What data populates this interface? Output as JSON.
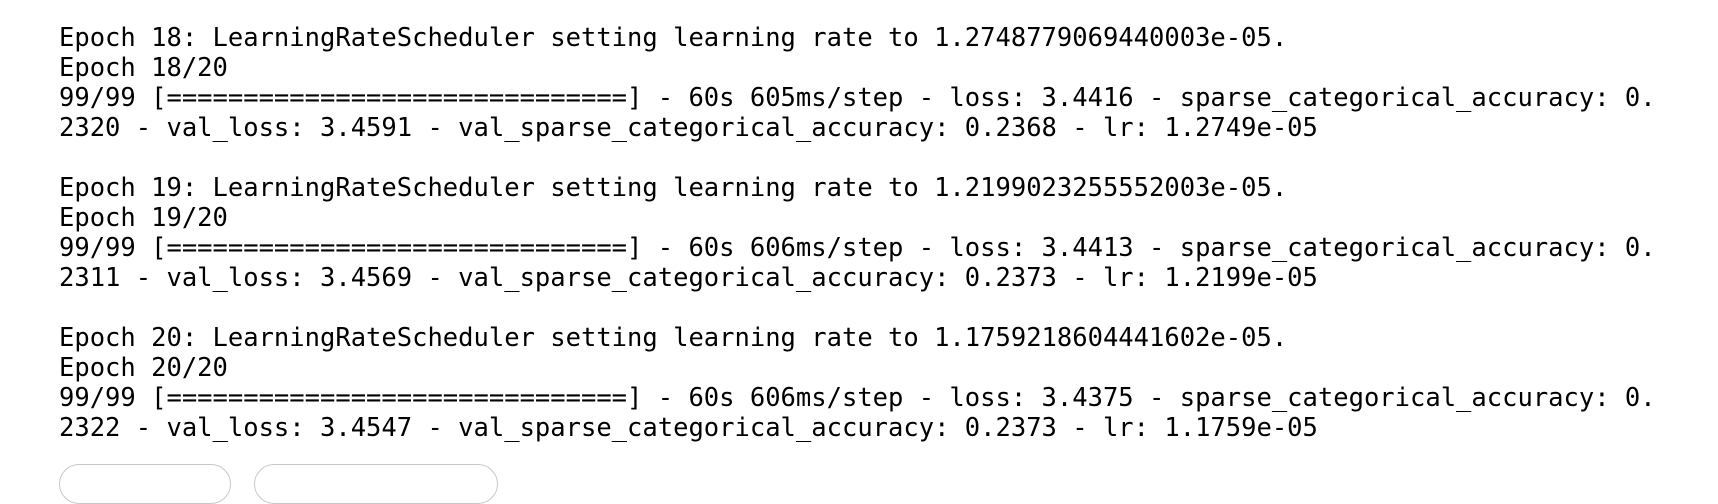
{
  "log": {
    "epochs": [
      {
        "scheduler_line": "Epoch 18: LearningRateScheduler setting learning rate to 1.2748779069440003e-05.",
        "header_line": "Epoch 18/20",
        "progress_line": "99/99 [==============================] - 60s 605ms/step - loss: 3.4416 - sparse_categorical_accuracy: 0.",
        "metrics_line": "2320 - val_loss: 3.4591 - val_sparse_categorical_accuracy: 0.2368 - lr: 1.2749e-05"
      },
      {
        "scheduler_line": "Epoch 19: LearningRateScheduler setting learning rate to 1.2199023255552003e-05.",
        "header_line": "Epoch 19/20",
        "progress_line": "99/99 [==============================] - 60s 606ms/step - loss: 3.4413 - sparse_categorical_accuracy: 0.",
        "metrics_line": "2311 - val_loss: 3.4569 - val_sparse_categorical_accuracy: 0.2373 - lr: 1.2199e-05"
      },
      {
        "scheduler_line": "Epoch 20: LearningRateScheduler setting learning rate to 1.1759218604441602e-05.",
        "header_line": "Epoch 20/20",
        "progress_line": "99/99 [==============================] - 60s 606ms/step - loss: 3.4375 - sparse_categorical_accuracy: 0.",
        "metrics_line": "2322 - val_loss: 3.4547 - val_sparse_categorical_accuracy: 0.2373 - lr: 1.1759e-05"
      }
    ]
  }
}
